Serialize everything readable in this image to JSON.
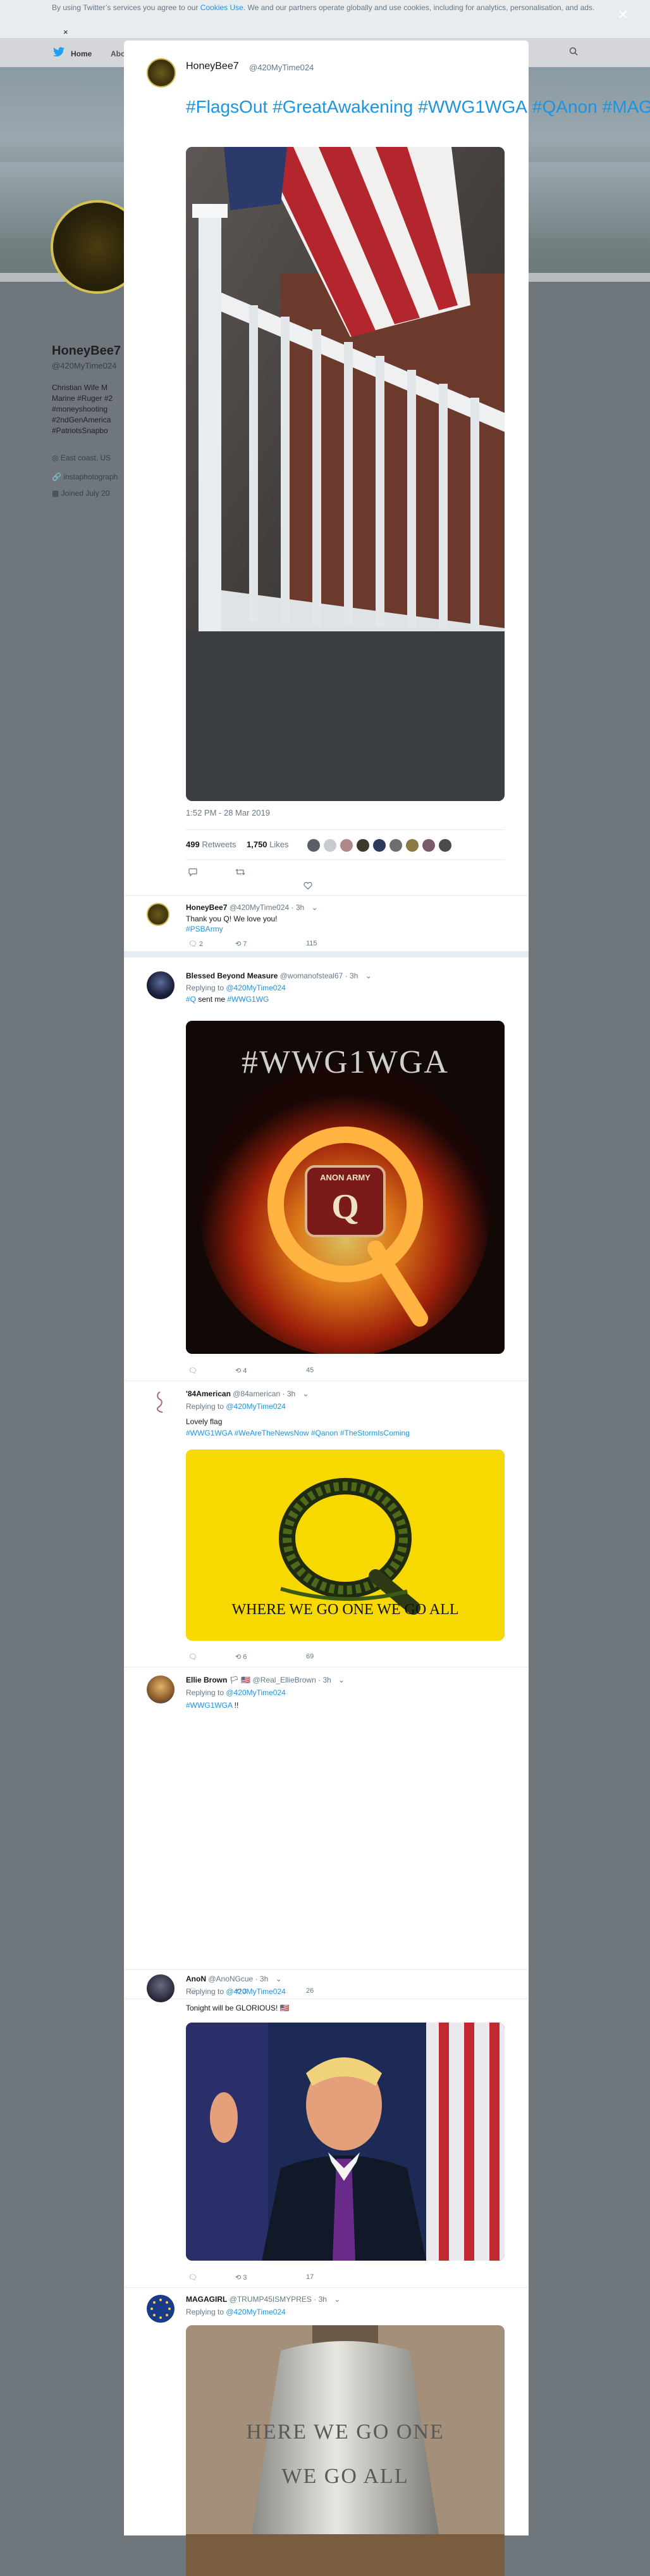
{
  "cookie": {
    "text_prefix": "By using Twitter’s services you agree to our ",
    "link": "Cookies Use",
    "text_suffix": ". We and our partners operate globally and use cookies, including for analytics, personalisation, and ads.",
    "close": "×"
  },
  "nav": {
    "home": "Home",
    "about": "Abo",
    "right_fragment": "≡ ▾"
  },
  "background_profile": {
    "name": "HoneyBee7",
    "handle": "@420MyTime024",
    "bio_lines": [
      "Christian  Wife  M",
      "Marine #Ruger #2",
      "#moneyshooting",
      "#2ndGenAmerica",
      "#PatriotsSnapbo"
    ],
    "location": "East coast, US",
    "website": "instaphotograph",
    "joined": "Joined July 20"
  },
  "modal": {
    "close_label": "×",
    "tweet": {
      "author_name": "HoneyBee7",
      "author_handle": "@420MyTime024",
      "hashtags": [
        "#FlagsOut",
        "#GreatAwakening",
        "#WWG1WGA",
        "#QAnon",
        "#MAGA"
      ],
      "timestamp": "1:52 PM - 28 Mar 2019",
      "retweets_count": "499",
      "retweets_label": "Retweets",
      "likes_count": "1,750",
      "likes_label": "Likes"
    },
    "replies": [
      {
        "name": "HoneyBee7",
        "handle": "@420MyTime024",
        "time": "3h",
        "text": "Thank you Q! We love you!",
        "hashtags": "#PSBArmy",
        "replying_to": "",
        "counts": {
          "reply": "2",
          "retweet": "7",
          "like": "115"
        }
      },
      {
        "name": "Blessed Beyond Measure",
        "handle": "@womanofsteal67",
        "time": "3h",
        "replying_prefix": "Replying to ",
        "replying_to": "@420MyTime024",
        "text_hashtag_a": "#Q",
        "text": " sent me ",
        "text_hashtag_b": "#WWG1WG",
        "image_title": "#WWG1WGA",
        "image_badge": "ANON ARMY",
        "image_letter": "Q",
        "counts": {
          "reply": "",
          "retweet": "4",
          "like": "45"
        }
      },
      {
        "name": "'84American",
        "handle": "@84american",
        "time": "3h",
        "replying_prefix": "Replying to ",
        "replying_to": "@420MyTime024",
        "text": "Lovely flag",
        "hashtags": "#WWG1WGA #WeAreTheNewsNow #Qanon #TheStormIsComing",
        "image_caption": "WHERE WE GO ONE WE GO ALL",
        "image_letter": "Q",
        "counts": {
          "reply": "",
          "retweet": "6",
          "like": "69"
        }
      },
      {
        "name": "Ellie Brown",
        "name_flags": "🏳 🇺🇸",
        "handle": "@Real_EllieBrown",
        "time": "3h",
        "replying_prefix": "Replying to ",
        "replying_to": "@420MyTime024",
        "hashtags": "#WWG1WGA",
        "text": " !!",
        "counts": {
          "reply": "",
          "retweet": "3",
          "like": "26"
        }
      },
      {
        "name": "AnoN",
        "handle": "@AnoNGcue",
        "time": "3h",
        "replying_prefix": "Replying to ",
        "replying_to": "@420MyTime024",
        "text": "Tonight will be GLORIOUS! 🇺🇸",
        "counts": {
          "reply": "",
          "retweet": "3",
          "like": "17"
        }
      },
      {
        "name": "MAGAGIRL",
        "handle": "@TRUMP45ISMYPRES",
        "time": "3h",
        "replying_prefix": "Replying to ",
        "replying_to": "@420MyTime024",
        "image_text_a": "HERE WE GO ONE",
        "image_text_b": "WE GO ALL"
      }
    ],
    "dropdown_glyph": "⌄"
  },
  "colors": {
    "link": "#1b95e0",
    "secondary": "#657786",
    "overlay": "#6f767c"
  }
}
